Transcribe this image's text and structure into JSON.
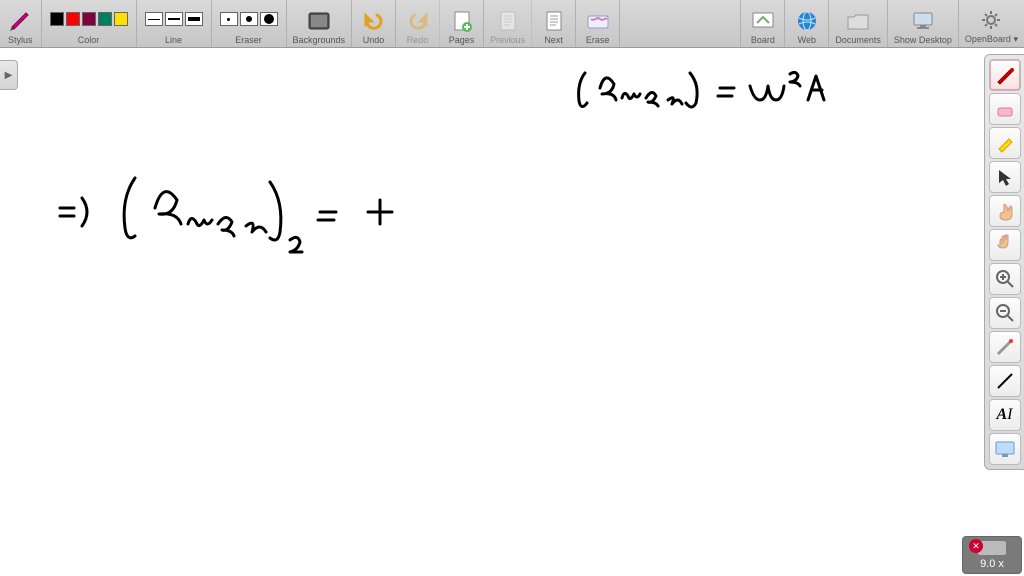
{
  "toolbar": {
    "stylus": "Stylus",
    "color": "Color",
    "line": "Line",
    "eraser": "Eraser",
    "backgrounds": "Backgrounds",
    "undo": "Undo",
    "redo": "Redo",
    "pages": "Pages",
    "previous": "Previous",
    "next": "Next",
    "erase": "Erase",
    "board": "Board",
    "web": "Web",
    "documents": "Documents",
    "show_desktop": "Show Desktop",
    "openboard": "OpenBoard"
  },
  "colors": [
    "#000000",
    "#ff0000",
    "#800040",
    "#008060",
    "#ffe000"
  ],
  "zoom": "9.0 x",
  "handwriting": {
    "eq1": "(aₘₐₓ)  =  ω²A",
    "eq2_lhs": "=)   (aₘₐₓ)",
    "eq2_sub": "2",
    "eq2_mid": "=",
    "eq2_rhs": "+"
  }
}
